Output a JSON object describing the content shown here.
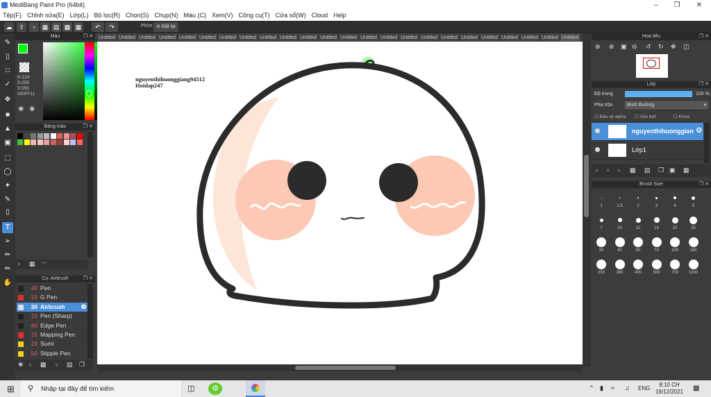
{
  "window": {
    "title": "MediBang Paint Pro (64bit)"
  },
  "menu": [
    "Tệp(F)",
    "Chỉnh sửa(E)",
    "Lớp(L)",
    "Bộ lọc(R)",
    "Chọn(S)",
    "Chụp(N)",
    "Màu (C)",
    "Xem(V)",
    "Công cụ(T)",
    "Cửa sổ(W)",
    "Cloud",
    "Help"
  ],
  "toolbar": {
    "hotkey_label": "Phím",
    "reset_label": "Đặt lại"
  },
  "color": {
    "title": "Màu",
    "h": "H:124",
    "s": "S:255",
    "v": "V:255",
    "hex": "#00FF11",
    "primary": "#00ff11"
  },
  "palette": {
    "title": "Bảng màu",
    "colors": [
      "#000000",
      "#444444",
      "#777777",
      "#999999",
      "#bbbbbb",
      "#ffffff",
      "#e06060",
      "#f09090",
      "#b05050",
      "#ff0000",
      "#40c040",
      "#ffff00",
      "#f4b8b8",
      "#f7c5c5",
      "#e8a0a0",
      "#d06060",
      "#9a4040",
      "#ffd0d0",
      "#c0c0ff",
      "#ff6060"
    ],
    "footer": "---"
  },
  "brush": {
    "title": "Cọ: Airbrush",
    "items": [
      {
        "size": "40",
        "name": "Pen",
        "color": "#222222"
      },
      {
        "size": "15",
        "name": "G Pen",
        "color": "#e03030"
      },
      {
        "size": "30",
        "name": "Airbrush",
        "color": "#dddddd",
        "selected": true
      },
      {
        "size": "10",
        "name": "Pen (Sharp)",
        "color": "#222222"
      },
      {
        "size": "40",
        "name": "Edge Pen",
        "color": "#222222"
      },
      {
        "size": "15",
        "name": "Mapping Pen",
        "color": "#e03030"
      },
      {
        "size": "19",
        "name": "Sumi",
        "color": "#f0d020"
      },
      {
        "size": "50",
        "name": "Stipple Pen",
        "color": "#f0d020"
      }
    ]
  },
  "tabs": [
    "Untitled",
    "Untitled",
    "Untitled",
    "Untitled",
    "Untitled",
    "Untitled",
    "Untitled",
    "Untitled",
    "Untitled",
    "Untitled",
    "Untitled",
    "Untitled",
    "Untitled",
    "Untitled",
    "Untitled",
    "Untitled",
    "Untitled",
    "Untitled",
    "Untitled",
    "Untitled",
    "Untitled",
    "Untitled",
    "Untitled",
    "Untitled"
  ],
  "canvas": {
    "watermark1": "nguyenthihuonggiang94512",
    "watermark2": "Hoidap247"
  },
  "navigator": {
    "title": "Hoa tiêu"
  },
  "layers": {
    "title": "Lớp",
    "opacity_label": "Độ trong",
    "opacity_value": "100 %",
    "blend_label": "Pha trộn",
    "blend_value": "Bình thường",
    "protect_alpha": "Bảo vệ alpha",
    "clip": "Xén bớt",
    "lock": "Khóa",
    "items": [
      {
        "name": "nguyenthihuonggian",
        "selected": true
      },
      {
        "name": "Lớp1",
        "selected": false
      }
    ]
  },
  "brush_size": {
    "title": "Brush Size",
    "sizes": [
      "1",
      "1.5",
      "2",
      "3",
      "4",
      "5",
      "7",
      "10",
      "12",
      "15",
      "20",
      "25",
      "30",
      "40",
      "50",
      "70",
      "100",
      "150",
      "200",
      "300",
      "400",
      "500",
      "700",
      "1000"
    ]
  },
  "taskbar": {
    "search_placeholder": "Nhập tại đây để tìm kiếm",
    "lang": "ENG",
    "time": "8:10 CH",
    "date": "19/12/2021"
  }
}
